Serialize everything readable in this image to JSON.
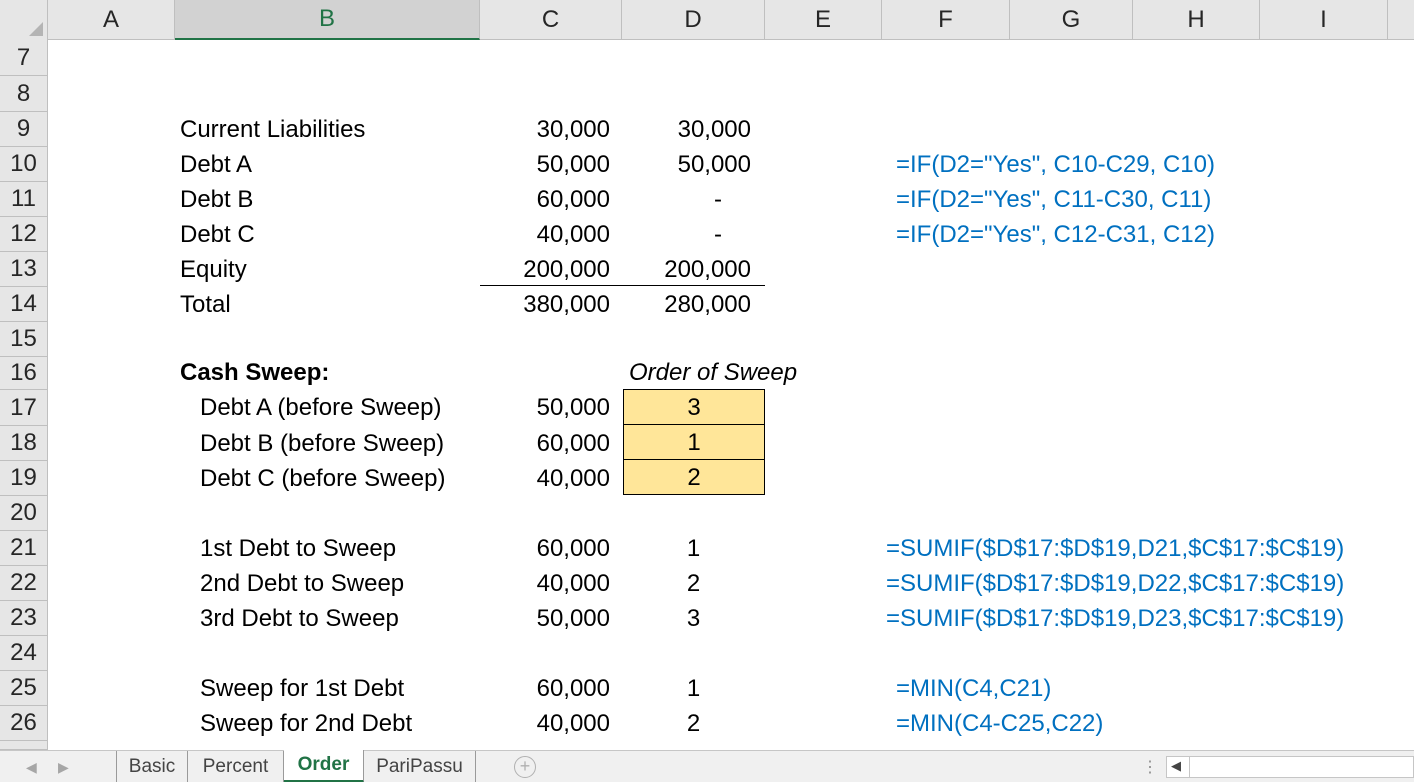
{
  "columns": [
    "A",
    "B",
    "C",
    "D",
    "E",
    "F",
    "G",
    "H",
    "I"
  ],
  "rows": [
    "7",
    "8",
    "9",
    "10",
    "11",
    "12",
    "13",
    "14",
    "15",
    "16",
    "17",
    "18",
    "19",
    "20",
    "21",
    "22",
    "23",
    "24",
    "25",
    "26"
  ],
  "balance": [
    {
      "label": "Current Liabilities",
      "c": "30,000",
      "d": "30,000",
      "formula": ""
    },
    {
      "label": "Debt A",
      "c": "50,000",
      "d": "50,000",
      "formula": "=IF(D2=\"Yes\", C10-C29, C10)"
    },
    {
      "label": "Debt B",
      "c": "60,000",
      "d": "-",
      "formula": "=IF(D2=\"Yes\", C11-C30, C11)"
    },
    {
      "label": "Debt C",
      "c": "40,000",
      "d": "-",
      "formula": "=IF(D2=\"Yes\", C12-C31, C12)"
    },
    {
      "label": "Equity",
      "c": "200,000",
      "d": "200,000",
      "formula": ""
    },
    {
      "label": "Total",
      "c": "380,000",
      "d": "280,000",
      "formula": ""
    }
  ],
  "sweep": {
    "title": "Cash Sweep:",
    "order_header": "Order of Sweep",
    "before": [
      {
        "label": "Debt A (before Sweep)",
        "c": "50,000",
        "order": "3"
      },
      {
        "label": "Debt B (before Sweep)",
        "c": "60,000",
        "order": "1"
      },
      {
        "label": "Debt C (before Sweep)",
        "c": "40,000",
        "order": "2"
      }
    ],
    "to_sweep": [
      {
        "label": "1st Debt to Sweep",
        "c": "60,000",
        "d": "1",
        "formula": "=SUMIF($D$17:$D$19,D21,$C$17:$C$19)"
      },
      {
        "label": "2nd Debt to Sweep",
        "c": "40,000",
        "d": "2",
        "formula": "=SUMIF($D$17:$D$19,D22,$C$17:$C$19)"
      },
      {
        "label": "3rd Debt to Sweep",
        "c": "50,000",
        "d": "3",
        "formula": "=SUMIF($D$17:$D$19,D23,$C$17:$C$19)"
      }
    ],
    "sweep_for": [
      {
        "label": "Sweep for 1st Debt",
        "c": "60,000",
        "d": "1",
        "formula": "=MIN(C4,C21)"
      },
      {
        "label": "Sweep for 2nd Debt",
        "c": "40,000",
        "d": "2",
        "formula": "=MIN(C4-C25,C22)"
      }
    ]
  },
  "tabs": [
    "Basic",
    "Percent",
    "Order",
    "PariPassu"
  ],
  "active_tab": "Order",
  "colors": {
    "formula": "#0070c0",
    "input_fill": "#ffe699",
    "accent": "#217346"
  }
}
